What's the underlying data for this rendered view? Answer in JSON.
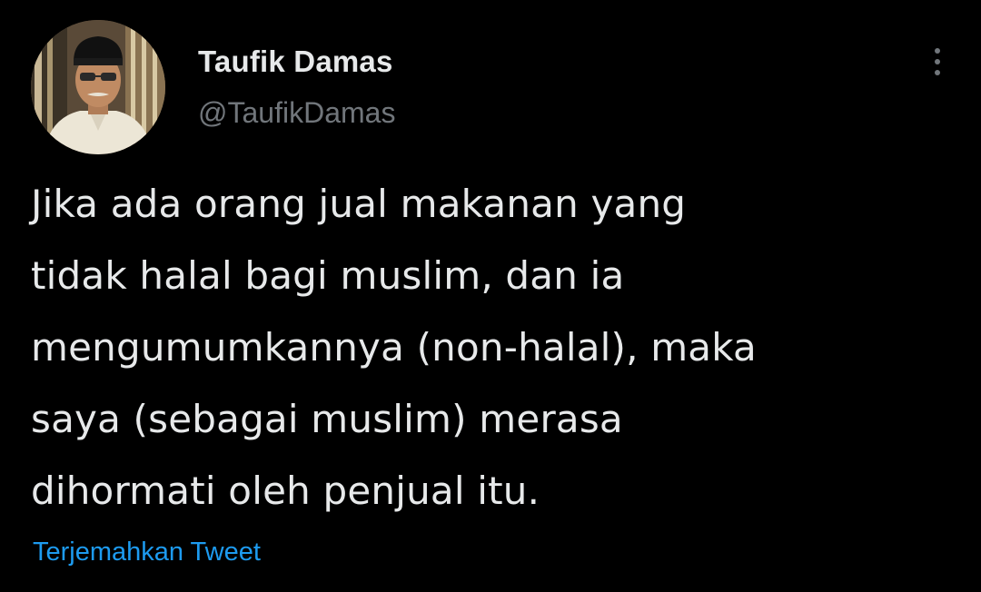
{
  "author": {
    "display_name": "Taufik Damas",
    "handle": "@TaufikDamas",
    "avatar_icon": "profile-photo"
  },
  "more_icon": "more-options-icon",
  "tweet": {
    "lines": [
      "Jika ada orang jual makanan yang",
      "tidak halal bagi muslim, dan ia",
      "mengumumkannya (non-halal), maka",
      "saya (sebagai muslim) merasa",
      "dihormati oleh penjual itu."
    ]
  },
  "translate_label": "Terjemahkan Tweet",
  "colors": {
    "background": "#000000",
    "text_primary": "#e7e9ea",
    "text_secondary": "#71767b",
    "link": "#1d9bf0"
  }
}
